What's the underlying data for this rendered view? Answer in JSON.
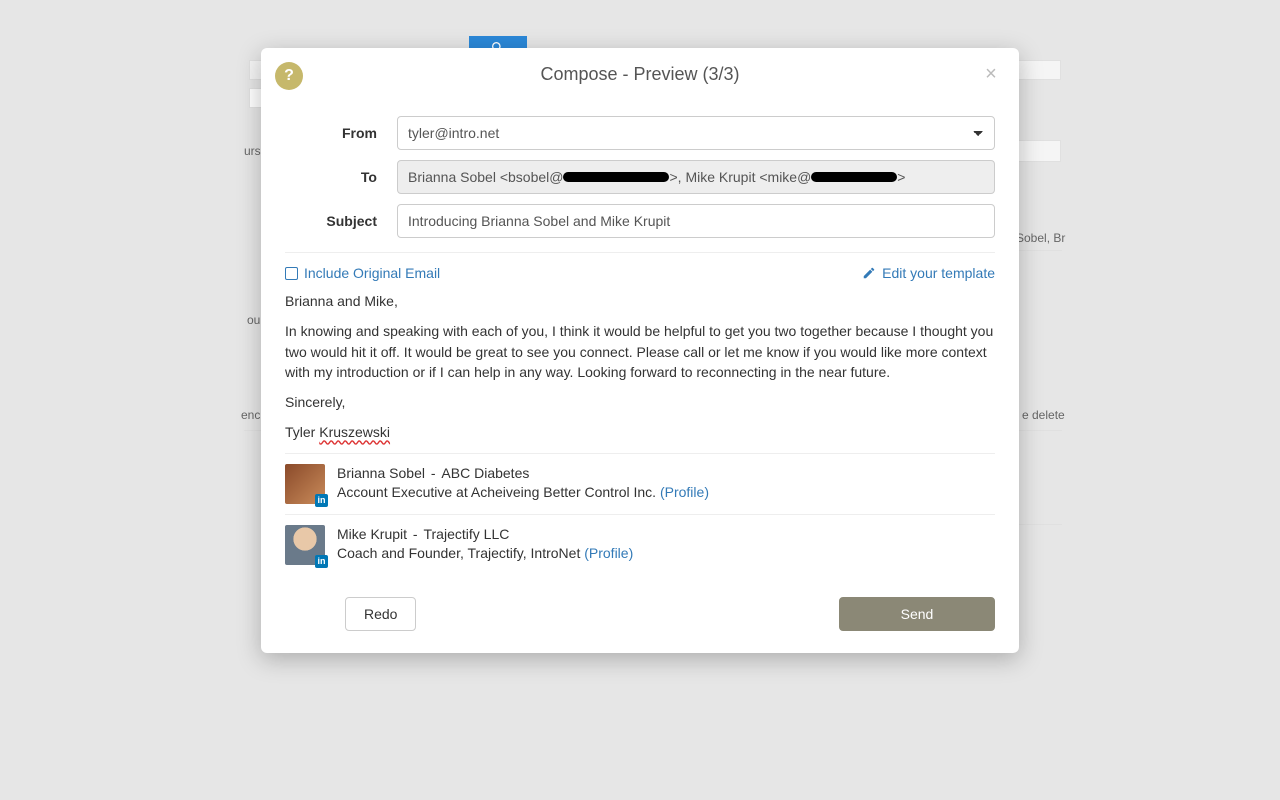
{
  "modal": {
    "title": "Compose - Preview (3/3)",
    "help_label": "?",
    "close_label": "×"
  },
  "form": {
    "from_label": "From",
    "from_value": "tyler@intro.net",
    "to_label": "To",
    "to_prefix1": "Brianna Sobel <bsobel@",
    "to_mid": ">, Mike Krupit <mike@",
    "to_suffix": ">",
    "subject_label": "Subject",
    "subject_value": "Introducing Brianna Sobel and Mike Krupit"
  },
  "toolbar": {
    "include_original": "Include Original Email",
    "edit_template": "Edit your template"
  },
  "body": {
    "greeting": "Brianna and Mike,",
    "para1": "In knowing and speaking with each of you, I think it would be helpful to get you two together because I thought you two would hit it off. It would be great to see you connect. Please call or let me know if you would like more context with my introduction or if I can help in any way. Looking forward to reconnecting in the near future.",
    "signoff": "Sincerely,",
    "sig_first": "Tyler ",
    "sig_last": "Kruszewski"
  },
  "contacts": [
    {
      "name_first": "Brianna ",
      "name_last": "Sobel",
      "company": "ABC Diabetes",
      "title_pre": "Account Executive at ",
      "title_err": "Acheiveing",
      "title_post": " Better Control Inc. ",
      "profile": "(Profile)",
      "avatar_bg": "linear-gradient(135deg,#8a4a2a,#c98b5a)"
    },
    {
      "name_first": "Mike ",
      "name_last": "Krupit",
      "company_err": "Trajectify",
      "company_post": " LLC",
      "title_pre": "Coach and Founder, ",
      "title_err1": "Trajectify",
      "title_mid": ", ",
      "title_err2": "IntroNet",
      "title_post": " ",
      "profile": "(Profile)",
      "avatar_bg": "radial-gradient(circle at 50% 35%, #e8c8a8 35%, #6a7a8a 36%)"
    }
  ],
  "footer": {
    "redo": "Redo",
    "send": "Send"
  },
  "bg": {
    "t1": "urs",
    "t2": "ou",
    "t3": "enc",
    "t4": "Sobel, Br",
    "t5": "e delete"
  }
}
